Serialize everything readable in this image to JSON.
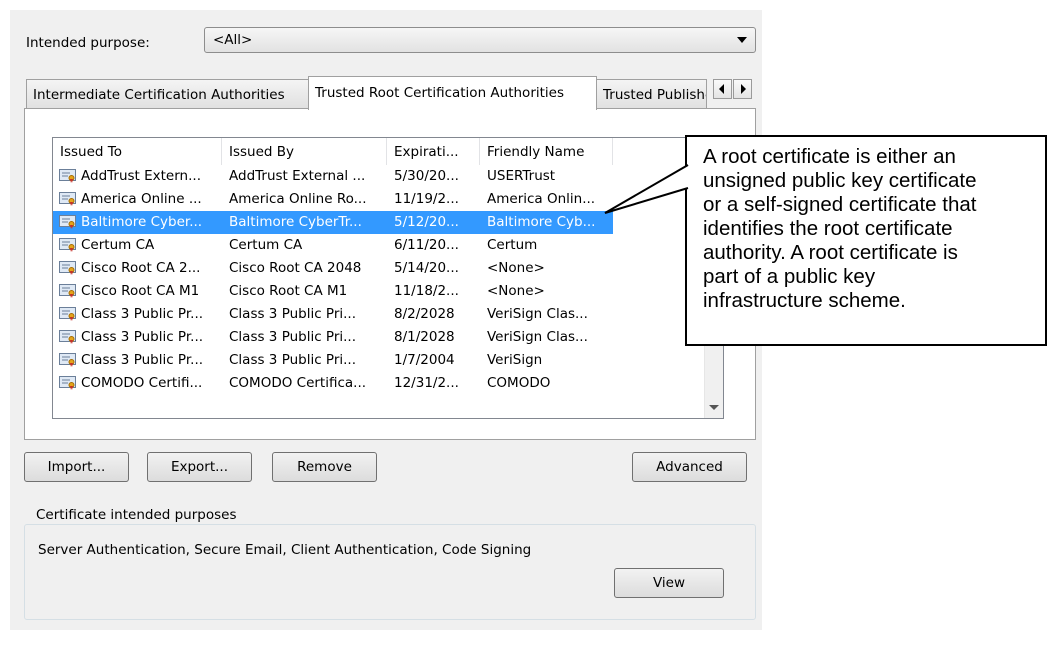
{
  "purpose": {
    "label": "Intended purpose:",
    "value": "<All>"
  },
  "tabs": [
    {
      "label": "Intermediate Certification Authorities"
    },
    {
      "label": "Trusted Root Certification Authorities"
    },
    {
      "label": "Trusted Publishers"
    }
  ],
  "list": {
    "columns": [
      "Issued To",
      "Issued By",
      "Expirati...",
      "Friendly Name"
    ],
    "rows": [
      {
        "issued_to": "AddTrust Extern...",
        "issued_by": "AddTrust External ...",
        "expiration": "5/30/20...",
        "friendly_name": "USERTrust"
      },
      {
        "issued_to": "America Online ...",
        "issued_by": "America Online Ro...",
        "expiration": "11/19/2...",
        "friendly_name": "America Onlin..."
      },
      {
        "issued_to": "Baltimore Cyber...",
        "issued_by": "Baltimore CyberTr...",
        "expiration": "5/12/20...",
        "friendly_name": "Baltimore Cyb..."
      },
      {
        "issued_to": "Certum CA",
        "issued_by": "Certum CA",
        "expiration": "6/11/20...",
        "friendly_name": "Certum"
      },
      {
        "issued_to": "Cisco Root CA 2...",
        "issued_by": "Cisco Root CA 2048",
        "expiration": "5/14/20...",
        "friendly_name": "<None>"
      },
      {
        "issued_to": "Cisco Root CA M1",
        "issued_by": "Cisco Root CA M1",
        "expiration": "11/18/2...",
        "friendly_name": "<None>"
      },
      {
        "issued_to": "Class 3 Public Pr...",
        "issued_by": "Class 3 Public Pri...",
        "expiration": "8/2/2028",
        "friendly_name": "VeriSign Clas..."
      },
      {
        "issued_to": "Class 3 Public Pr...",
        "issued_by": "Class 3 Public Pri...",
        "expiration": "8/1/2028",
        "friendly_name": "VeriSign Clas..."
      },
      {
        "issued_to": "Class 3 Public Pr...",
        "issued_by": "Class 3 Public Pri...",
        "expiration": "1/7/2004",
        "friendly_name": "VeriSign"
      },
      {
        "issued_to": "COMODO Certifi...",
        "issued_by": "COMODO Certifica...",
        "expiration": "12/31/2...",
        "friendly_name": "COMODO"
      }
    ]
  },
  "buttons": {
    "import": "Import...",
    "export": "Export...",
    "remove": "Remove",
    "advanced": "Advanced",
    "view": "View"
  },
  "purposes_group": {
    "title": "Certificate intended purposes",
    "text": "Server Authentication, Secure Email, Client Authentication, Code Signing"
  },
  "callout": {
    "lines": [
      "A root certificate is either an",
      "unsigned public key certificate",
      "or a self-signed certificate that",
      "identifies the root certificate",
      "authority. A root certificate is",
      "part of a public key",
      "infrastructure scheme."
    ]
  },
  "colors": {
    "selection": "#3399ff",
    "dialog_bg": "#f0f0f0"
  },
  "icons": {
    "row_icon": "certificate-icon"
  }
}
